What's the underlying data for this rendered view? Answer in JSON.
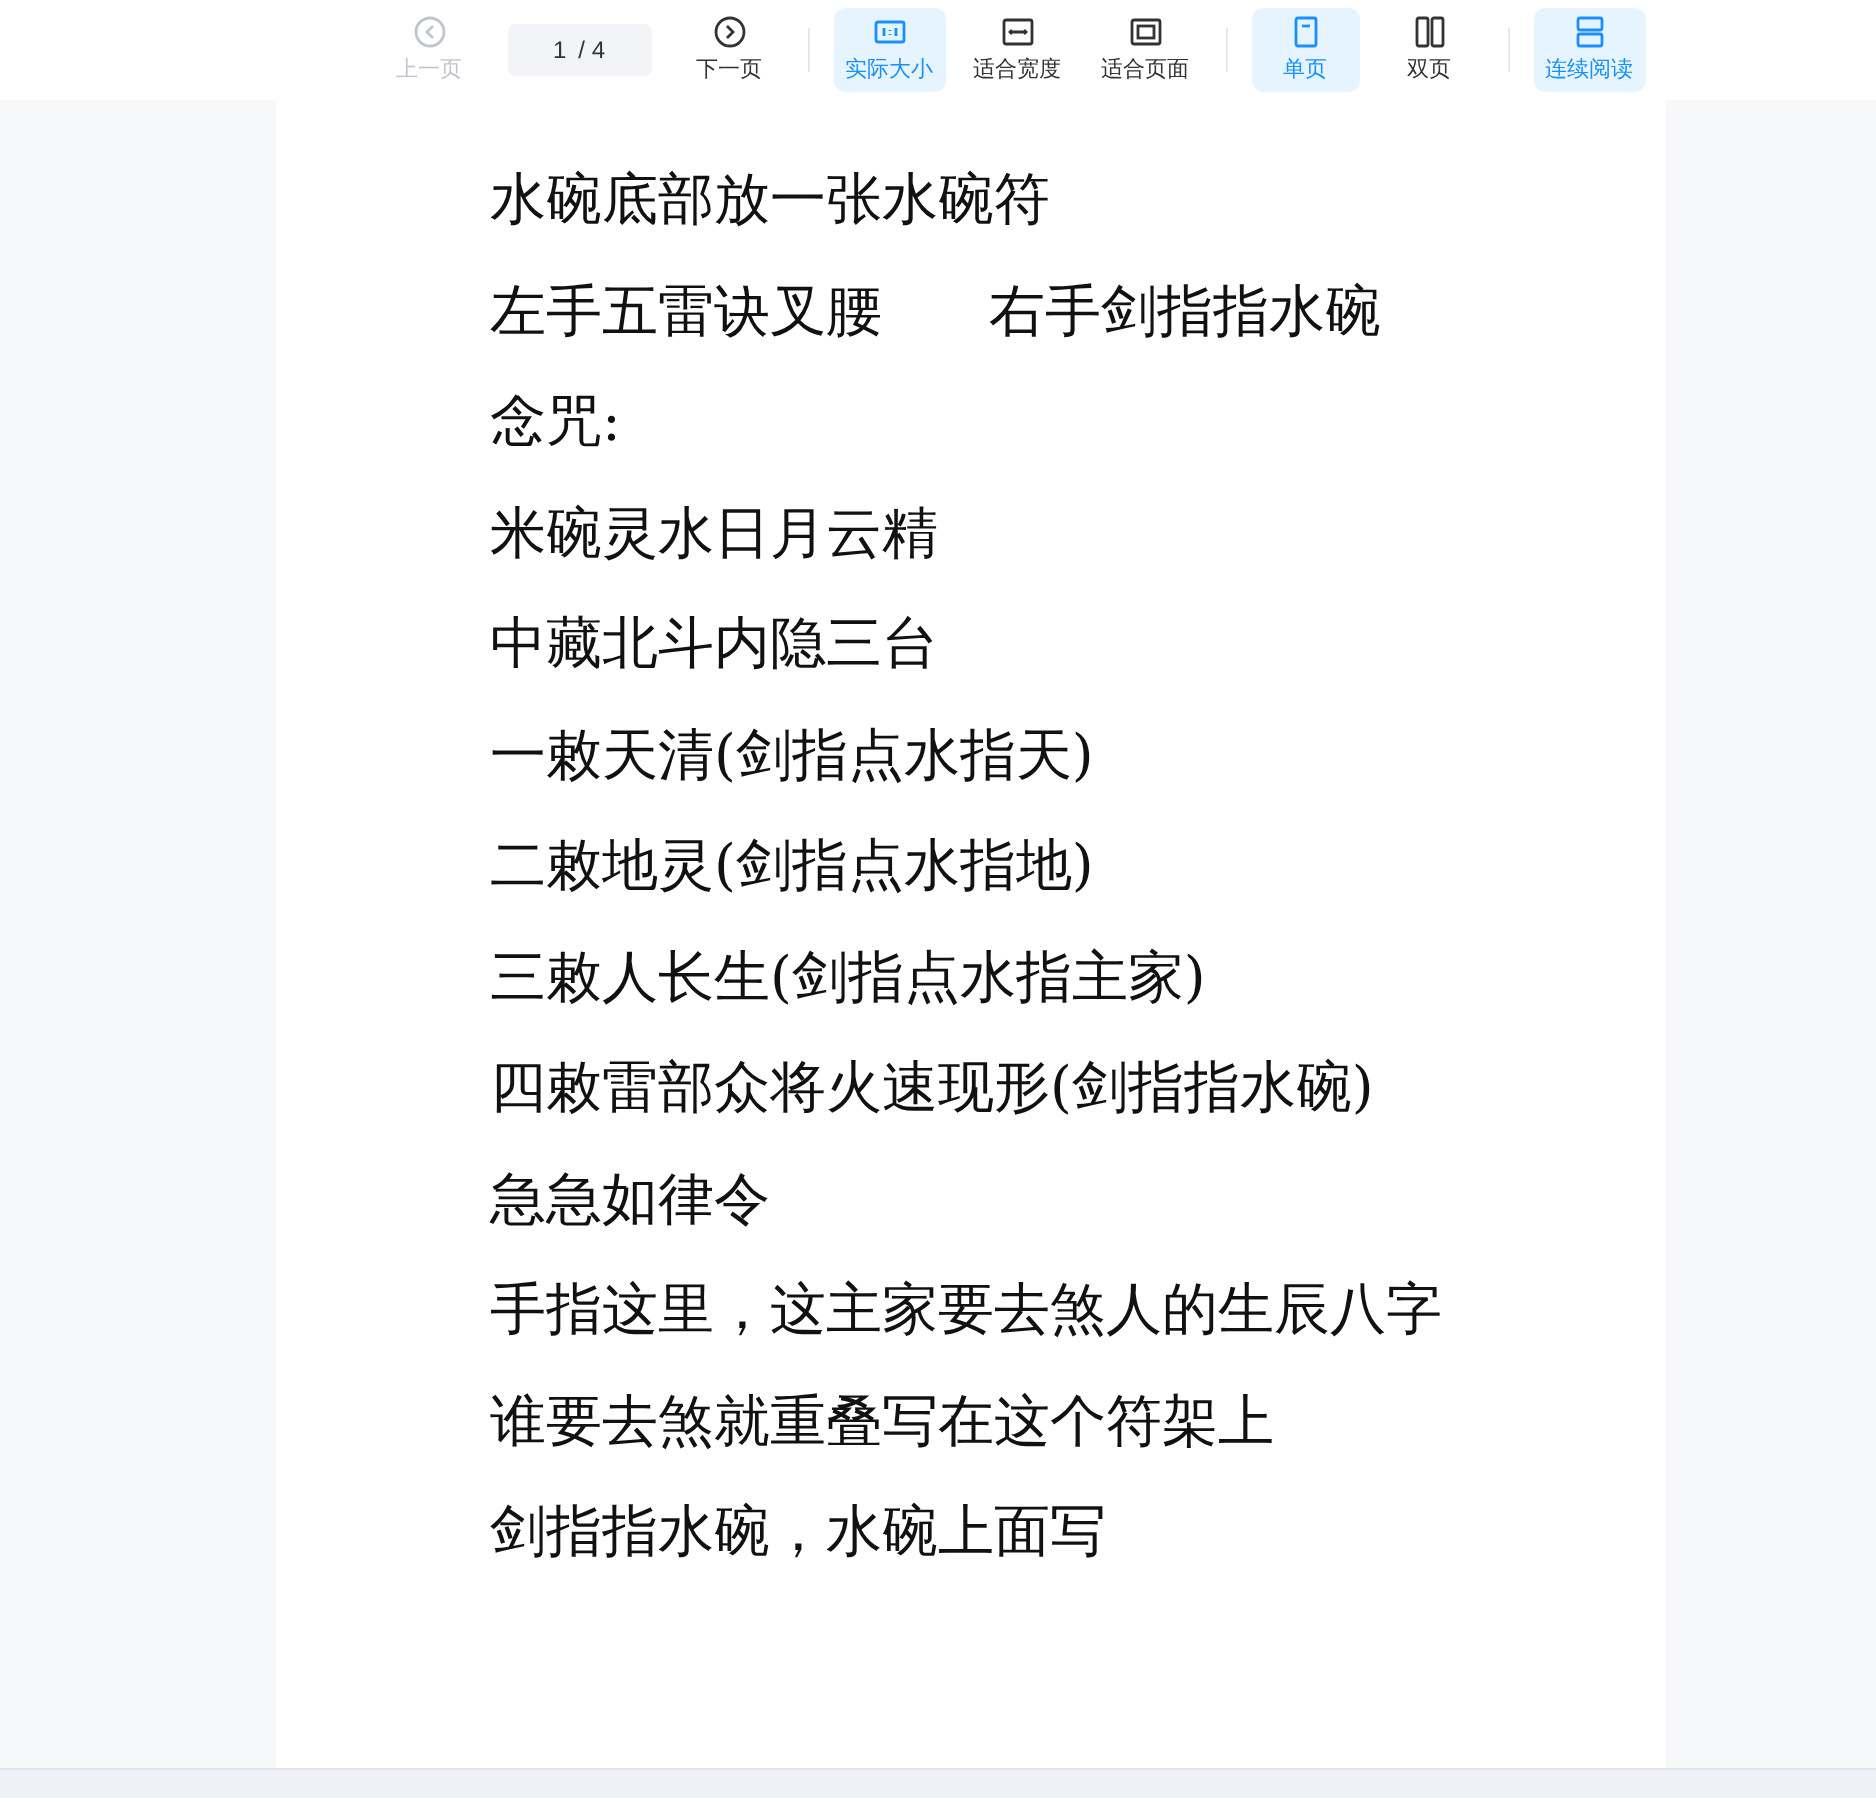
{
  "toolbar": {
    "nav": [
      {
        "kind": "prev",
        "label": "上一页",
        "disabled": true
      },
      {
        "kind": "page",
        "value": "1",
        "total": "/ 4"
      },
      {
        "kind": "next",
        "label": "下一页",
        "disabled": false
      }
    ],
    "zoom": [
      {
        "kind": "actual",
        "label": "实际大小",
        "selected": true
      },
      {
        "kind": "width",
        "label": "适合宽度",
        "selected": false
      },
      {
        "kind": "page",
        "label": "适合页面",
        "selected": false
      }
    ],
    "layout": [
      {
        "kind": "single",
        "label": "单页",
        "selected": true
      },
      {
        "kind": "double",
        "label": "双页",
        "selected": false
      }
    ],
    "mode": [
      {
        "kind": "continuous",
        "label": "连续阅读",
        "selected": true
      }
    ]
  },
  "document": {
    "lines": [
      "水碗底部放一张水碗符",
      "左手五雷诀叉腰      右手剑指指水碗",
      "念咒:",
      "米碗灵水日月云精",
      "中藏北斗内隐三台",
      "一敕天清(剑指点水指天)",
      "二敕地灵(剑指点水指地)",
      "三敕人长生(剑指点水指主家)",
      "四敕雷部众将火速现形(剑指指水碗)",
      "急急如律令",
      "手指这里，这主家要去煞人的生辰八字",
      "谁要去煞就重叠写在这个符架上",
      "剑指指水碗，水碗上面写"
    ]
  }
}
